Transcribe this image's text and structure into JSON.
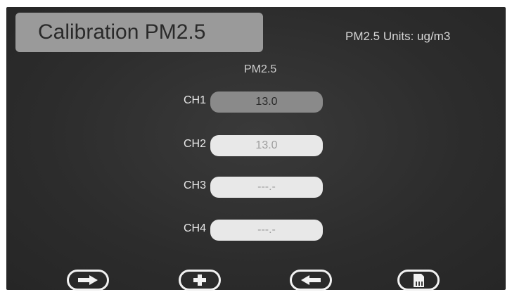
{
  "header": {
    "title": "Calibration PM2.5",
    "units": "PM2.5 Units: ug/m3"
  },
  "table": {
    "column_header": "PM2.5",
    "rows": [
      {
        "label": "CH1",
        "value": "13.0",
        "state": "selected"
      },
      {
        "label": "CH2",
        "value": "13.0",
        "state": "normal"
      },
      {
        "label": "CH3",
        "value": "---.-",
        "state": "normal"
      },
      {
        "label": "CH4",
        "value": "---.-",
        "state": "normal"
      }
    ]
  },
  "toolbar": {
    "buttons": [
      {
        "icon": "arrow-right-icon"
      },
      {
        "icon": "plus-icon"
      },
      {
        "icon": "arrow-left-icon"
      },
      {
        "icon": "memory-card-icon"
      }
    ]
  },
  "colors": {
    "screen_background": "#2f2f2f",
    "title_box": "#9a9a9a",
    "selected_field": "#8a8a8a",
    "normal_field": "#e8e8e8",
    "button_outline": "#f2f2f2"
  }
}
